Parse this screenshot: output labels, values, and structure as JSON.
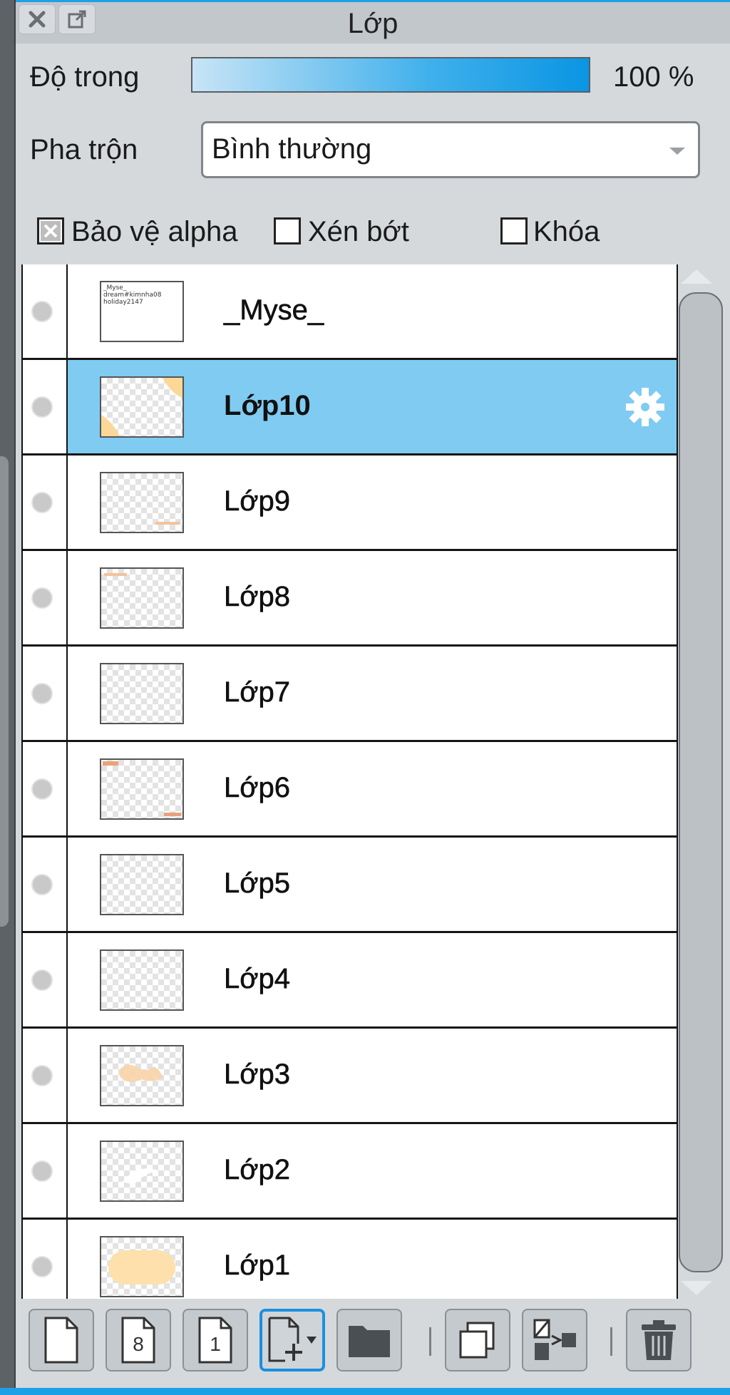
{
  "window": {
    "title": "Lớp"
  },
  "opacity": {
    "label": "Độ trong",
    "value": "100 %",
    "level_percent": 100
  },
  "blend": {
    "label": "Pha trộn",
    "selected": "Bình thường"
  },
  "options": {
    "alpha_lock": {
      "label": "Bảo vệ alpha",
      "checked": true
    },
    "clip": {
      "label": "Xén bớt",
      "checked": false
    },
    "lock": {
      "label": "Khóa",
      "checked": false
    }
  },
  "layers": [
    {
      "name": "_Myse_",
      "selected": false
    },
    {
      "name": "Lớp10",
      "selected": true
    },
    {
      "name": "Lớp9",
      "selected": false
    },
    {
      "name": "Lớp8",
      "selected": false
    },
    {
      "name": "Lớp7",
      "selected": false
    },
    {
      "name": "Lớp6",
      "selected": false
    },
    {
      "name": "Lớp5",
      "selected": false
    },
    {
      "name": "Lớp4",
      "selected": false
    },
    {
      "name": "Lớp3",
      "selected": false
    },
    {
      "name": "Lớp2",
      "selected": false
    },
    {
      "name": "Lớp1",
      "selected": false
    }
  ],
  "thumb_text": {
    "line1": "_Myse_",
    "line2": "dream#kimnha08",
    "line3": "holiday2147"
  },
  "toolbar": {
    "buttons": [
      {
        "icon": "new-layer-icon"
      },
      {
        "icon": "new-8bit-layer-icon",
        "glyph": "8"
      },
      {
        "icon": "new-1bit-layer-icon",
        "glyph": "1"
      },
      {
        "icon": "add-layer-menu-icon"
      },
      {
        "icon": "folder-icon"
      },
      {
        "icon": "duplicate-layer-icon"
      },
      {
        "icon": "merge-layer-icon"
      },
      {
        "icon": "trash-icon"
      }
    ]
  },
  "colors": {
    "accent": "#1ea0e6",
    "selected_row": "#80cbf2"
  }
}
